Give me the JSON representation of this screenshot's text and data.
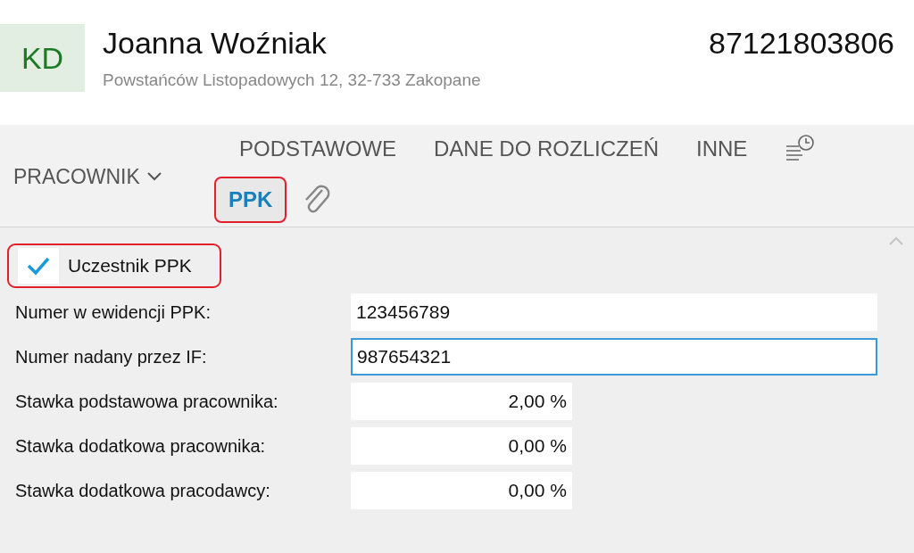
{
  "header": {
    "initials": "KD",
    "name": "Joanna Woźniak",
    "address": "Powstańców Listopadowych 12, 32-733 Zakopane",
    "id_number": "87121803806"
  },
  "section_dropdown": {
    "label": "PRACOWNIK"
  },
  "tabs": [
    {
      "label": "PODSTAWOWE",
      "selected": false
    },
    {
      "label": "DANE DO ROZLICZEŃ",
      "selected": false
    },
    {
      "label": "INNE",
      "selected": false
    }
  ],
  "second_row_tabs": [
    {
      "label": "PPK",
      "selected": true,
      "highlighted": true
    }
  ],
  "participant": {
    "label": "Uczestnik PPK",
    "checked": true,
    "highlighted": true
  },
  "fields": [
    {
      "label": "Numer w ewidencji PPK:",
      "value": "123456789",
      "kind": "text",
      "focused": false
    },
    {
      "label": "Numer nadany przez IF:",
      "value": "987654321",
      "kind": "text",
      "focused": true
    },
    {
      "label": "Stawka podstawowa pracownika:",
      "value": "2,00 %",
      "kind": "percent",
      "focused": false
    },
    {
      "label": "Stawka dodatkowa pracownika:",
      "value": "0,00 %",
      "kind": "percent",
      "focused": false
    },
    {
      "label": "Stawka dodatkowa pracodawcy:",
      "value": "0,00 %",
      "kind": "percent",
      "focused": false
    }
  ]
}
